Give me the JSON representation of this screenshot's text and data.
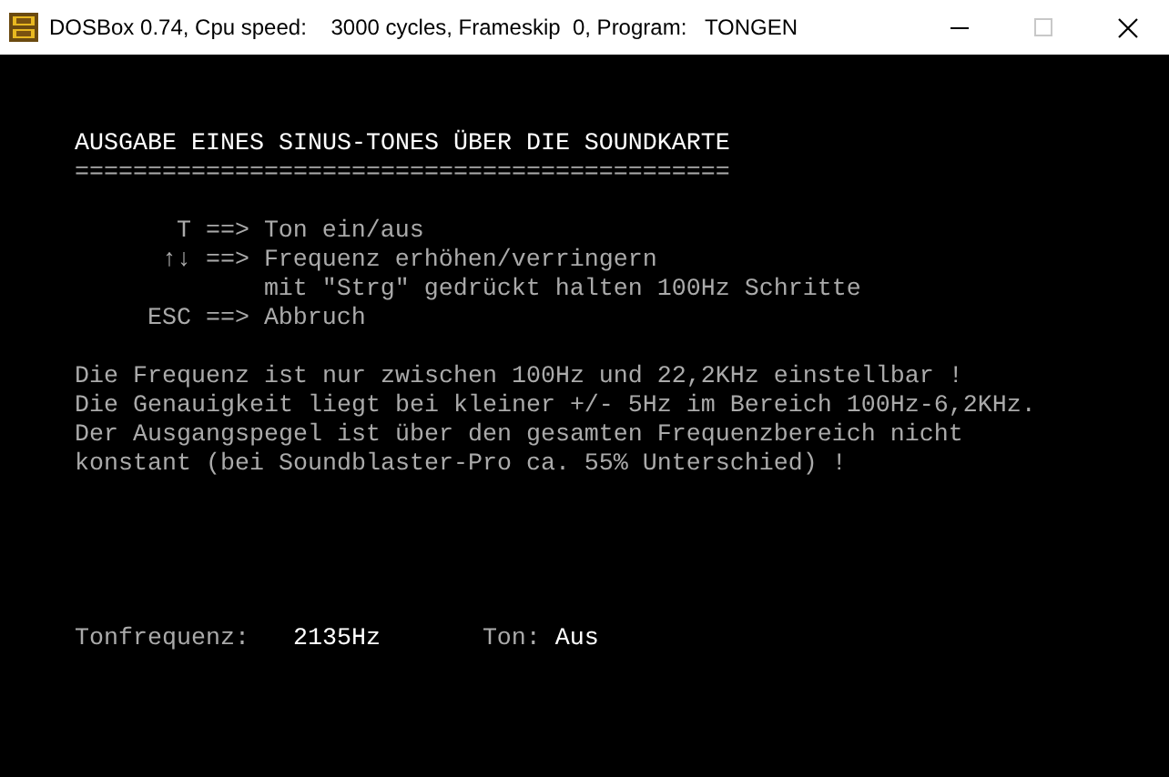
{
  "window": {
    "title": "DOSBox 0.74, Cpu speed:    3000 cycles, Frameskip  0, Program:   TONGEN",
    "maximize_disabled": true
  },
  "screen": {
    "heading": "AUSGABE EINES SINUS-TONES ÜBER DIE SOUNDKARTE",
    "underline": "=============================================",
    "keys": [
      {
        "key": "T",
        "arrow": "==>",
        "description": "Ton ein/aus"
      },
      {
        "key": "↑↓",
        "arrow": "==>",
        "description": "Frequenz erhöhen/verringern"
      },
      {
        "description": "mit \"Strg\" gedrückt halten 100Hz Schritte"
      },
      {
        "key": "ESC",
        "arrow": "==>",
        "description": "Abbruch"
      }
    ],
    "notes": [
      "Die Frequenz ist nur zwischen 100Hz und 22,2KHz einstellbar !",
      "Die Genauigkeit liegt bei kleiner +/- 5Hz im Bereich 100Hz-6,2KHz.",
      "Der Ausgangspegel ist über den gesamten Frequenzbereich nicht",
      "konstant (bei Soundblaster-Pro ca. 55% Unterschied) !"
    ],
    "status": {
      "frequency_label": "Tonfrequenz:",
      "frequency": "2135Hz",
      "tone_label": "Ton:",
      "tone": "Aus"
    }
  }
}
